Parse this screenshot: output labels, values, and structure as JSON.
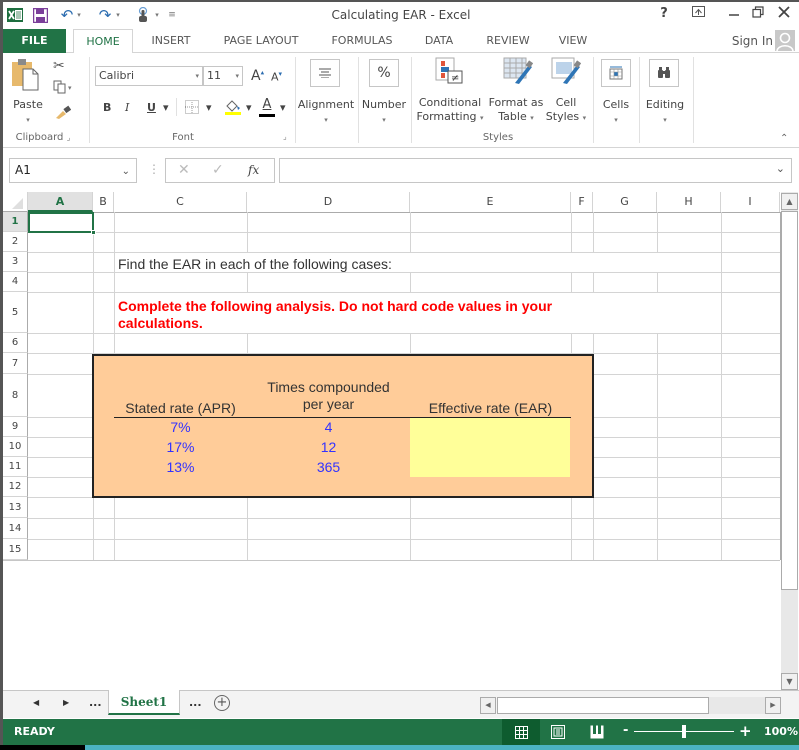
{
  "title_bar": {
    "app_title": "Calculating EAR - Excel",
    "quick_access": [
      "excel-logo",
      "save",
      "undo",
      "redo",
      "touch-mode",
      "customize"
    ],
    "window_buttons": {
      "help": "?",
      "ribbon_display": "⊼",
      "minimize": "—",
      "restore": "❐",
      "close": "✕"
    }
  },
  "ribbon_tabs": [
    {
      "label": "FILE",
      "active": false
    },
    {
      "label": "HOME",
      "active": true
    },
    {
      "label": "INSERT",
      "active": false
    },
    {
      "label": "PAGE LAYOUT",
      "active": false
    },
    {
      "label": "FORMULAS",
      "active": false
    },
    {
      "label": "DATA",
      "active": false
    },
    {
      "label": "REVIEW",
      "active": false
    },
    {
      "label": "VIEW",
      "active": false
    }
  ],
  "sign_in": "Sign In",
  "ribbon": {
    "clipboard": {
      "paste": "Paste",
      "group_label": "Clipboard"
    },
    "font": {
      "name": "Calibri",
      "size": "11",
      "bold": "B",
      "italic": "I",
      "underline": "U",
      "grow": "A",
      "shrink": "A",
      "font_color_glyph": "A",
      "group_label": "Font",
      "fill_color": "#ffff00",
      "font_color": "#000000"
    },
    "alignment": {
      "label": "Alignment"
    },
    "number": {
      "label": "Number",
      "glyph": "%"
    },
    "styles": {
      "conditional_formatting": [
        "Conditional",
        "Formatting"
      ],
      "format_as_table": [
        "Format as",
        "Table"
      ],
      "cell_styles": [
        "Cell",
        "Styles"
      ],
      "group_label": "Styles"
    },
    "cells": {
      "label": "Cells"
    },
    "editing": {
      "label": "Editing"
    }
  },
  "formula_bar": {
    "name_box": "A1",
    "fx": "fx",
    "formula": ""
  },
  "columns": [
    "A",
    "B",
    "C",
    "D",
    "E",
    "F",
    "G",
    "H",
    "I"
  ],
  "selected_column": "A",
  "rows": [
    "1",
    "2",
    "3",
    "4",
    "5",
    "6",
    "7",
    "8",
    "9",
    "10",
    "11",
    "12",
    "13",
    "14",
    "15"
  ],
  "selected_row": "1",
  "cells": {
    "C3": "Find the EAR in each of the following cases:",
    "C5_line1": "Complete the following analysis. Do not hard code values in your",
    "C5_line2": "calculations.",
    "D8_line1": "Times compounded",
    "D8_line2": "per year",
    "C8": "Stated rate (APR)",
    "E8": "Effective rate (EAR)",
    "table_rows": [
      {
        "apr": "7%",
        "times": "4",
        "ear": ""
      },
      {
        "apr": "17%",
        "times": "12",
        "ear": ""
      },
      {
        "apr": "13%",
        "times": "365",
        "ear": ""
      }
    ]
  },
  "colors": {
    "excel_green": "#217346",
    "instruction_red": "#ff0000",
    "input_blue": "#3333ff",
    "table_fill": "#ffcc99",
    "output_fill": "#ffff99"
  },
  "sheet_tabs": {
    "prev": "◀",
    "next": "▶",
    "ellipsis_left": "...",
    "active_sheet": "Sheet1",
    "ellipsis_right": "...",
    "add": "+"
  },
  "status_bar": {
    "status": "READY",
    "zoom": "100%",
    "zoom_level_percent": 100,
    "zoom_minus": "-",
    "zoom_plus": "+"
  }
}
